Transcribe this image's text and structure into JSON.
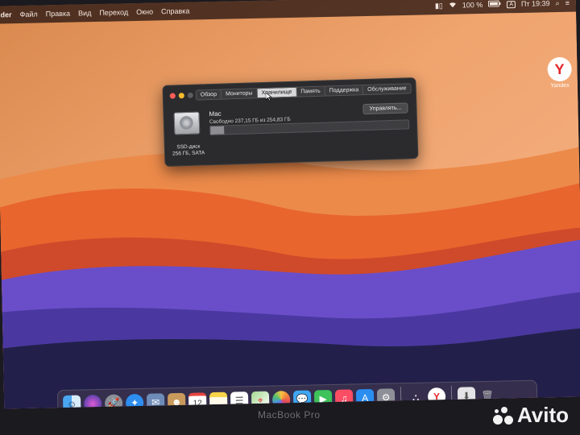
{
  "menubar": {
    "app": "nder",
    "items": [
      "Файл",
      "Правка",
      "Вид",
      "Переход",
      "Окно",
      "Справка"
    ],
    "battery": "100 %",
    "keyboard": "A",
    "clock": "Пт 19:39"
  },
  "desktop": {
    "yandex_label": "Yandex"
  },
  "about_window": {
    "tabs": [
      "Обзор",
      "Мониторы",
      "Хранилище",
      "Память",
      "Поддержка",
      "Обслуживание"
    ],
    "active_tab": "Хранилище",
    "volume_name": "Mac",
    "free_text": "Свободно 237,15 ГБ из 254,83 ГБ",
    "manage_label": "Управлять...",
    "disk_label_line1": "SSD-диск",
    "disk_label_line2": "256 ГБ, SATA",
    "used_fraction": 0.07
  },
  "dock": {
    "calendar_day": "12",
    "apps": [
      "finder-icon",
      "siri-icon",
      "launchpad-icon",
      "safari-icon",
      "mail-icon",
      "contacts-icon",
      "calendar-icon",
      "notes-icon",
      "reminders-icon",
      "maps-icon",
      "photos-icon",
      "messages-icon",
      "facetime-icon",
      "music-icon",
      "app-store-icon",
      "system-preferences-icon",
      "airdrop-icon",
      "yandex-icon",
      "downloads-icon",
      "trash-icon"
    ]
  },
  "hardware": {
    "bezel_label": "MacBook Pro"
  },
  "watermark": {
    "text": "Avito"
  }
}
